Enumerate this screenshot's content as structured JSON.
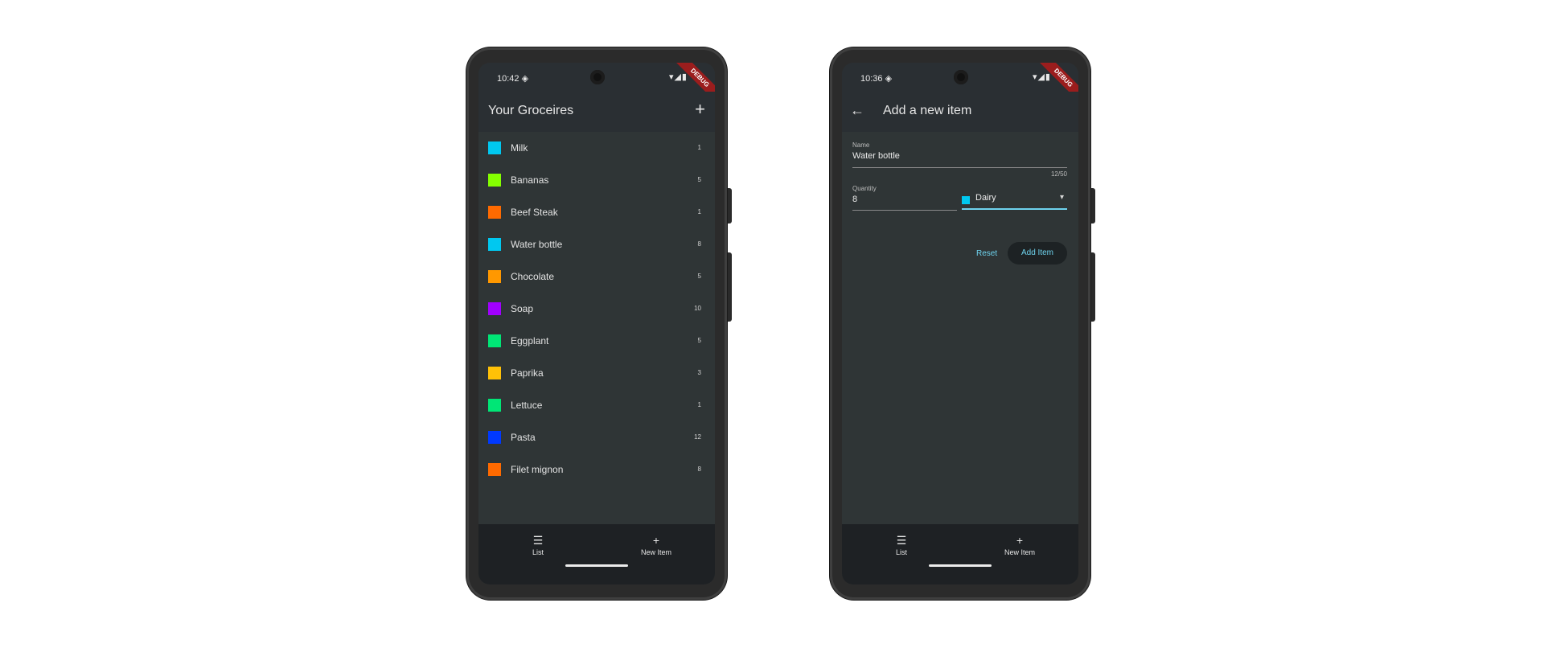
{
  "left_phone": {
    "status": {
      "time": "10:42 ◈",
      "system": "▾◢▮",
      "debug": "DEBUG"
    },
    "appbar": {
      "title": "Your Groceires",
      "add_icon": "+"
    },
    "items": [
      {
        "name": "Milk",
        "qty": "1",
        "color": "#00c8f0"
      },
      {
        "name": "Bananas",
        "qty": "5",
        "color": "#84ff00"
      },
      {
        "name": "Beef Steak",
        "qty": "1",
        "color": "#ff6a00"
      },
      {
        "name": "Water bottle",
        "qty": "8",
        "color": "#00c8f0"
      },
      {
        "name": "Chocolate",
        "qty": "5",
        "color": "#ff9800"
      },
      {
        "name": "Soap",
        "qty": "10",
        "color": "#a100ff"
      },
      {
        "name": "Eggplant",
        "qty": "5",
        "color": "#00e676"
      },
      {
        "name": "Paprika",
        "qty": "3",
        "color": "#ffc107"
      },
      {
        "name": "Lettuce",
        "qty": "1",
        "color": "#00e676"
      },
      {
        "name": "Pasta",
        "qty": "12",
        "color": "#0039ff"
      },
      {
        "name": "Filet mignon",
        "qty": "8",
        "color": "#ff6a00"
      }
    ],
    "nav": [
      {
        "icon": "☰",
        "label": "List"
      },
      {
        "icon": "+",
        "label": "New Item"
      }
    ]
  },
  "right_phone": {
    "status": {
      "time": "10:36 ◈",
      "system": "▾◢▮",
      "debug": "DEBUG"
    },
    "appbar": {
      "back_icon": "←",
      "title": "Add a new item"
    },
    "form": {
      "name_label": "Name",
      "name_value": "Water bottle",
      "name_counter": "12/50",
      "quantity_label": "Quantity",
      "quantity_value": "8",
      "category_value": "Dairy",
      "category_color": "#00c8f0",
      "dropdown_icon": "▾",
      "reset_label": "Reset",
      "add_label": "Add Item"
    },
    "nav": [
      {
        "icon": "☰",
        "label": "List"
      },
      {
        "icon": "+",
        "label": "New Item"
      }
    ]
  }
}
